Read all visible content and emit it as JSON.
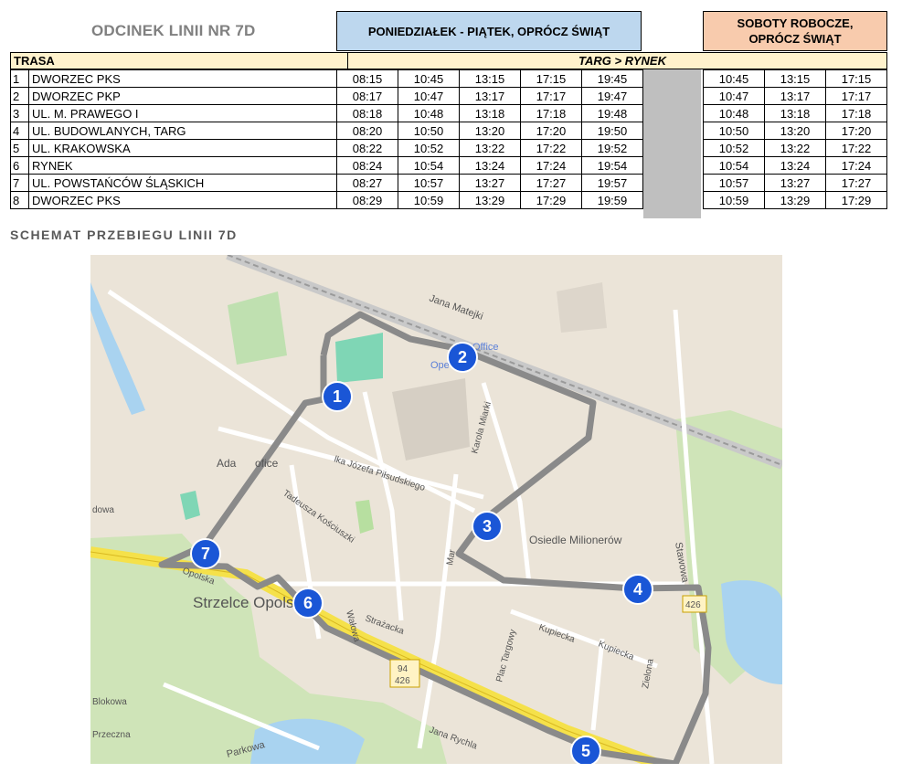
{
  "header": {
    "title": "ODCINEK LINII NR 7D",
    "weekdays": "PONIEDZIAŁEK - PIĄTEK, OPRÓCZ ŚWIĄT",
    "saturdays": "SOBOTY ROBOCZE,\nOPRÓCZ ŚWIĄT",
    "route_label": "TRASA",
    "direction": "TARG > RYNEK"
  },
  "stops": [
    {
      "num": "1",
      "name": "DWORZEC PKS",
      "week": [
        "08:15",
        "10:45",
        "13:15",
        "17:15",
        "19:45"
      ],
      "sat": [
        "10:45",
        "13:15",
        "17:15"
      ]
    },
    {
      "num": "2",
      "name": "DWORZEC PKP",
      "week": [
        "08:17",
        "10:47",
        "13:17",
        "17:17",
        "19:47"
      ],
      "sat": [
        "10:47",
        "13:17",
        "17:17"
      ]
    },
    {
      "num": "3",
      "name": "UL. M. PRAWEGO I",
      "week": [
        "08:18",
        "10:48",
        "13:18",
        "17:18",
        "19:48"
      ],
      "sat": [
        "10:48",
        "13:18",
        "17:18"
      ]
    },
    {
      "num": "4",
      "name": "UL. BUDOWLANYCH, TARG",
      "week": [
        "08:20",
        "10:50",
        "13:20",
        "17:20",
        "19:50"
      ],
      "sat": [
        "10:50",
        "13:20",
        "17:20"
      ]
    },
    {
      "num": "5",
      "name": "UL. KRAKOWSKA",
      "week": [
        "08:22",
        "10:52",
        "13:22",
        "17:22",
        "19:52"
      ],
      "sat": [
        "10:52",
        "13:22",
        "17:22"
      ]
    },
    {
      "num": "6",
      "name": "RYNEK",
      "week": [
        "08:24",
        "10:54",
        "13:24",
        "17:24",
        "19:54"
      ],
      "sat": [
        "10:54",
        "13:24",
        "17:24"
      ]
    },
    {
      "num": "7",
      "name": "UL. POWSTAŃCÓW ŚLĄSKICH",
      "week": [
        "08:27",
        "10:57",
        "13:27",
        "17:27",
        "19:57"
      ],
      "sat": [
        "10:57",
        "13:27",
        "17:27"
      ]
    },
    {
      "num": "8",
      "name": "DWORZEC PKS",
      "week": [
        "08:29",
        "10:59",
        "13:29",
        "17:29",
        "19:59"
      ],
      "sat": [
        "10:59",
        "13:29",
        "17:29"
      ]
    }
  ],
  "schema_title": "SCHEMAT PRZEBIEGU LINII 7D",
  "map": {
    "labels": {
      "street_matejki": "Jana Matejki",
      "station": "Office",
      "station2": "Ope",
      "street_marii": "Karola Miarki",
      "street_pilsudskiego": "lka Józefa Piłsudskiego",
      "street_kosciuszki": "Tadeusza Kościuszki",
      "district": "Osiedle Milionerów",
      "town": "Strzelce Opolskie",
      "street_opolska": "Opolska",
      "street_kupiecka": "Kupiecka",
      "street_kupiecka2": "Kupiecka",
      "street_targowy": "Plac Targowy",
      "street_strazacka": "Strażacka",
      "street_walowa": "Wałowa",
      "street_zielona": "Zielona",
      "street_stawowa": "Stawowa",
      "street_rychla": "Jana Rychla",
      "street_parkowa": "Parkowa",
      "street_blokowa": "Blokowa",
      "street_przeczna": "Przeczna",
      "street_dowa": "dowa",
      "ada": "Ada",
      "ada2": "ofice",
      "road_94": "94",
      "road_426": "426",
      "road_426b": "426",
      "street_marii2": "Mar"
    },
    "markers": [
      "1",
      "2",
      "3",
      "4",
      "5",
      "6",
      "7"
    ],
    "colors": {
      "route": "#8a8a8a",
      "marker": "#1a56d6",
      "main_road": "#f5e14a",
      "park": "#c8e0b0",
      "water": "#a9d3f0",
      "land": "#eae3d6"
    }
  }
}
